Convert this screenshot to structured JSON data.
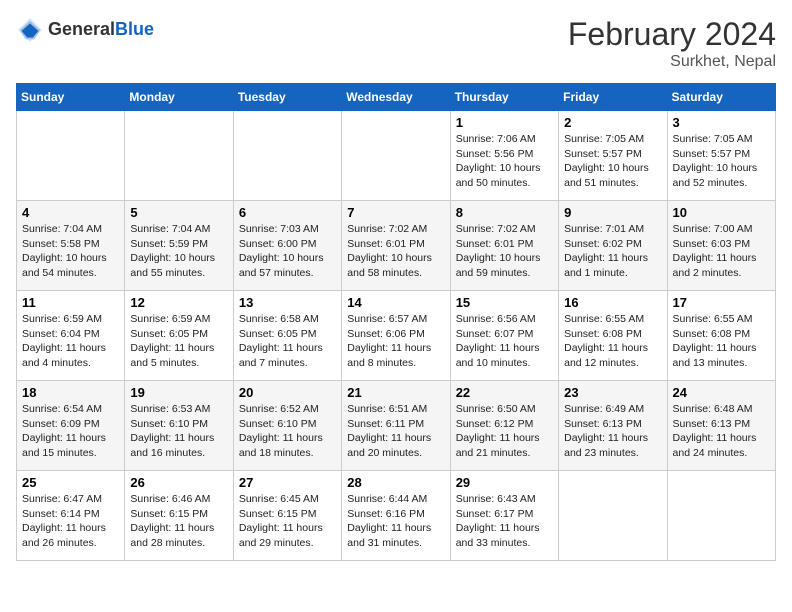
{
  "header": {
    "logo_general": "General",
    "logo_blue": "Blue",
    "month_year": "February 2024",
    "location": "Surkhet, Nepal"
  },
  "weekdays": [
    "Sunday",
    "Monday",
    "Tuesday",
    "Wednesday",
    "Thursday",
    "Friday",
    "Saturday"
  ],
  "weeks": [
    [
      {
        "day": "",
        "content": ""
      },
      {
        "day": "",
        "content": ""
      },
      {
        "day": "",
        "content": ""
      },
      {
        "day": "",
        "content": ""
      },
      {
        "day": "1",
        "content": "Sunrise: 7:06 AM\nSunset: 5:56 PM\nDaylight: 10 hours\nand 50 minutes."
      },
      {
        "day": "2",
        "content": "Sunrise: 7:05 AM\nSunset: 5:57 PM\nDaylight: 10 hours\nand 51 minutes."
      },
      {
        "day": "3",
        "content": "Sunrise: 7:05 AM\nSunset: 5:57 PM\nDaylight: 10 hours\nand 52 minutes."
      }
    ],
    [
      {
        "day": "4",
        "content": "Sunrise: 7:04 AM\nSunset: 5:58 PM\nDaylight: 10 hours\nand 54 minutes."
      },
      {
        "day": "5",
        "content": "Sunrise: 7:04 AM\nSunset: 5:59 PM\nDaylight: 10 hours\nand 55 minutes."
      },
      {
        "day": "6",
        "content": "Sunrise: 7:03 AM\nSunset: 6:00 PM\nDaylight: 10 hours\nand 57 minutes."
      },
      {
        "day": "7",
        "content": "Sunrise: 7:02 AM\nSunset: 6:01 PM\nDaylight: 10 hours\nand 58 minutes."
      },
      {
        "day": "8",
        "content": "Sunrise: 7:02 AM\nSunset: 6:01 PM\nDaylight: 10 hours\nand 59 minutes."
      },
      {
        "day": "9",
        "content": "Sunrise: 7:01 AM\nSunset: 6:02 PM\nDaylight: 11 hours\nand 1 minute."
      },
      {
        "day": "10",
        "content": "Sunrise: 7:00 AM\nSunset: 6:03 PM\nDaylight: 11 hours\nand 2 minutes."
      }
    ],
    [
      {
        "day": "11",
        "content": "Sunrise: 6:59 AM\nSunset: 6:04 PM\nDaylight: 11 hours\nand 4 minutes."
      },
      {
        "day": "12",
        "content": "Sunrise: 6:59 AM\nSunset: 6:05 PM\nDaylight: 11 hours\nand 5 minutes."
      },
      {
        "day": "13",
        "content": "Sunrise: 6:58 AM\nSunset: 6:05 PM\nDaylight: 11 hours\nand 7 minutes."
      },
      {
        "day": "14",
        "content": "Sunrise: 6:57 AM\nSunset: 6:06 PM\nDaylight: 11 hours\nand 8 minutes."
      },
      {
        "day": "15",
        "content": "Sunrise: 6:56 AM\nSunset: 6:07 PM\nDaylight: 11 hours\nand 10 minutes."
      },
      {
        "day": "16",
        "content": "Sunrise: 6:55 AM\nSunset: 6:08 PM\nDaylight: 11 hours\nand 12 minutes."
      },
      {
        "day": "17",
        "content": "Sunrise: 6:55 AM\nSunset: 6:08 PM\nDaylight: 11 hours\nand 13 minutes."
      }
    ],
    [
      {
        "day": "18",
        "content": "Sunrise: 6:54 AM\nSunset: 6:09 PM\nDaylight: 11 hours\nand 15 minutes."
      },
      {
        "day": "19",
        "content": "Sunrise: 6:53 AM\nSunset: 6:10 PM\nDaylight: 11 hours\nand 16 minutes."
      },
      {
        "day": "20",
        "content": "Sunrise: 6:52 AM\nSunset: 6:10 PM\nDaylight: 11 hours\nand 18 minutes."
      },
      {
        "day": "21",
        "content": "Sunrise: 6:51 AM\nSunset: 6:11 PM\nDaylight: 11 hours\nand 20 minutes."
      },
      {
        "day": "22",
        "content": "Sunrise: 6:50 AM\nSunset: 6:12 PM\nDaylight: 11 hours\nand 21 minutes."
      },
      {
        "day": "23",
        "content": "Sunrise: 6:49 AM\nSunset: 6:13 PM\nDaylight: 11 hours\nand 23 minutes."
      },
      {
        "day": "24",
        "content": "Sunrise: 6:48 AM\nSunset: 6:13 PM\nDaylight: 11 hours\nand 24 minutes."
      }
    ],
    [
      {
        "day": "25",
        "content": "Sunrise: 6:47 AM\nSunset: 6:14 PM\nDaylight: 11 hours\nand 26 minutes."
      },
      {
        "day": "26",
        "content": "Sunrise: 6:46 AM\nSunset: 6:15 PM\nDaylight: 11 hours\nand 28 minutes."
      },
      {
        "day": "27",
        "content": "Sunrise: 6:45 AM\nSunset: 6:15 PM\nDaylight: 11 hours\nand 29 minutes."
      },
      {
        "day": "28",
        "content": "Sunrise: 6:44 AM\nSunset: 6:16 PM\nDaylight: 11 hours\nand 31 minutes."
      },
      {
        "day": "29",
        "content": "Sunrise: 6:43 AM\nSunset: 6:17 PM\nDaylight: 11 hours\nand 33 minutes."
      },
      {
        "day": "",
        "content": ""
      },
      {
        "day": "",
        "content": ""
      }
    ]
  ]
}
